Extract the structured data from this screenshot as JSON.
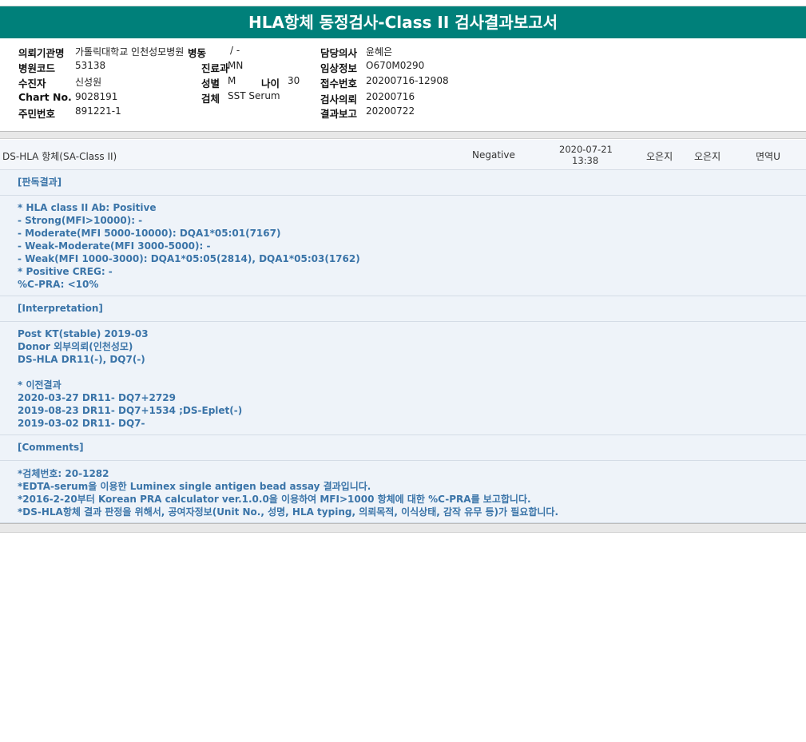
{
  "title": "HLA항체 동정검사-Class II 검사결과보고서",
  "info": {
    "institution_label": "의뢰기관명",
    "institution_value": "가톨릭대학교 인천성모병원",
    "ward_label": "병동",
    "ward_value": "/ -",
    "doctor_label": "담당의사",
    "doctor_value": "윤혜은",
    "hospital_code_label": "병원코드",
    "hospital_code_value": "53138",
    "department_label": "진료과",
    "department_value": "MN",
    "clinical_info_label": "임상정보",
    "clinical_info_value": "O670M0290",
    "receiver_label": "수진자",
    "receiver_value": "신성원",
    "sex_label": "성별",
    "sex_value": "M",
    "age_label": "나이",
    "age_value": "30",
    "receipt_no_label": "접수번호",
    "receipt_no_value": "20200716-12908",
    "chart_no_label": "Chart No.",
    "chart_no_value": "9028191",
    "specimen_label": "검체",
    "specimen_value": "SST Serum",
    "request_date_label": "검사의뢰",
    "request_date_value": "20200716",
    "id_no_label": "주민번호",
    "id_no_value": "891221-1",
    "report_date_label": "결과보고",
    "report_date_value": "20200722"
  },
  "result_row": {
    "test_name": "DS-HLA 항체(SA-Class II)",
    "result": "Negative",
    "date": "2020-07-21",
    "time": "13:38",
    "col1": "오은지",
    "col2": "오은지",
    "dept": "면역U"
  },
  "sections": {
    "judgement": {
      "heading": "[판독결과]",
      "lines": [
        "* HLA class II Ab: Positive",
        "- Strong(MFI>10000): -",
        "- Moderate(MFI 5000-10000): DQA1*05:01(7167)",
        "- Weak-Moderate(MFI 3000-5000): -",
        "- Weak(MFI 1000-3000): DQA1*05:05(2814), DQA1*05:03(1762)",
        "* Positive CREG: -",
        " %C-PRA: <10%"
      ]
    },
    "interpretation": {
      "heading": "[Interpretation]",
      "lines": [
        "Post KT(stable) 2019-03",
        "Donor 외부의뢰(인천성모)",
        "DS-HLA DR11(-), DQ7(-)",
        "",
        "* 이전결과",
        "2020-03-27 DR11- DQ7+2729",
        "2019-08-23 DR11- DQ7+1534 ;DS-Eplet(-)",
        "2019-03-02 DR11- DQ7-"
      ]
    },
    "comments": {
      "heading": "[Comments]",
      "lines": [
        "*검체번호: 20-1282",
        "*EDTA-serum을 이용한 Luminex single antigen bead assay 결과입니다.",
        "*2016-2-20부터 Korean PRA calculator ver.1.0.0을 이용하여 MFI>1000 항체에 대한 %C-PRA를 보고합니다.",
        "*DS-HLA항체 결과 판정을 위해서, 공여자정보(Unit No., 성명, HLA typing, 의뢰목적, 이식상태, 감작 유무 등)가 필요합니다."
      ]
    }
  }
}
